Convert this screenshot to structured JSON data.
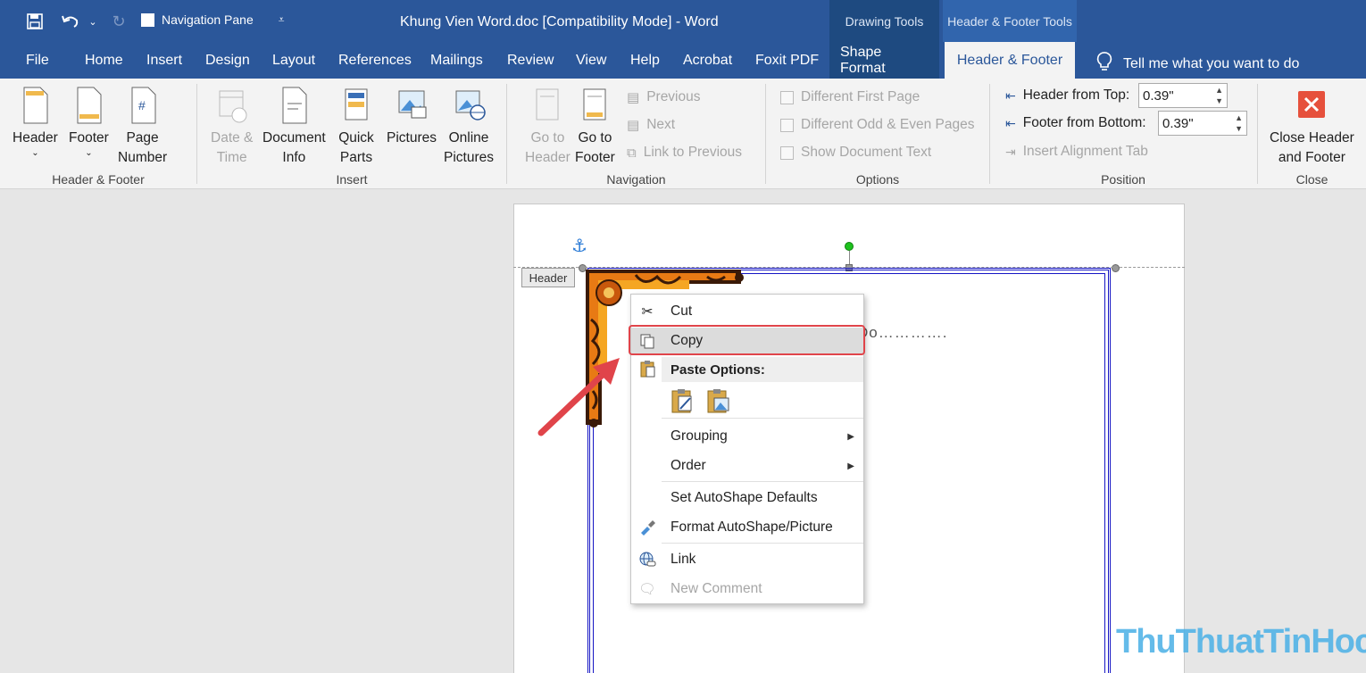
{
  "titlebar": {
    "nav_pane_label": "Navigation Pane",
    "doc_title": "Khung Vien Word.doc [Compatibility Mode]  -  Word",
    "drawing_tools": "Drawing Tools",
    "hf_tools": "Header & Footer Tools"
  },
  "tabs": {
    "file": "File",
    "home": "Home",
    "insert": "Insert",
    "design": "Design",
    "layout": "Layout",
    "references": "References",
    "mailings": "Mailings",
    "review": "Review",
    "view": "View",
    "help": "Help",
    "acrobat": "Acrobat",
    "foxit": "Foxit PDF",
    "shape_format": "Shape Format",
    "header_footer": "Header & Footer",
    "tell_me": "Tell me what you want to do"
  },
  "ribbon": {
    "hf_group": {
      "label": "Header & Footer",
      "header": "Header",
      "footer": "Footer",
      "page_number_1": "Page",
      "page_number_2": "Number"
    },
    "insert_group": {
      "label": "Insert",
      "date_1": "Date &",
      "date_2": "Time",
      "docinfo_1": "Document",
      "docinfo_2": "Info",
      "quick_1": "Quick",
      "quick_2": "Parts",
      "pictures": "Pictures",
      "online_1": "Online",
      "online_2": "Pictures"
    },
    "nav_group": {
      "label": "Navigation",
      "goto_header_1": "Go to",
      "goto_header_2": "Header",
      "goto_footer_1": "Go to",
      "goto_footer_2": "Footer",
      "previous": "Previous",
      "next": "Next",
      "link_prev": "Link to Previous"
    },
    "options_group": {
      "label": "Options",
      "diff_first": "Different First Page",
      "diff_odd_even": "Different Odd & Even Pages",
      "show_doc_text": "Show Document Text"
    },
    "position_group": {
      "label": "Position",
      "header_top": "Header from Top:",
      "header_top_value": "0.39\"",
      "footer_bottom": "Footer from Bottom:",
      "footer_bottom_value": "0.39\"",
      "insert_align": "Insert Alignment Tab"
    },
    "close_group": {
      "label": "Close",
      "close_1": "Close Header",
      "close_2": "and Footer"
    }
  },
  "document": {
    "header_tag": "Header",
    "partial_text": "Do…………."
  },
  "context_menu": {
    "cut": "Cut",
    "copy": "Copy",
    "paste_options": "Paste Options:",
    "grouping": "Grouping",
    "order": "Order",
    "set_defaults": "Set AutoShape Defaults",
    "format_shape": "Format AutoShape/Picture",
    "link": "Link",
    "new_comment": "New Comment"
  },
  "watermark": "ThuThuatTinHoc.vn",
  "colors": {
    "word_blue": "#2b579a",
    "highlight_red": "#e0444a",
    "frame_blue": "#1515c4"
  }
}
